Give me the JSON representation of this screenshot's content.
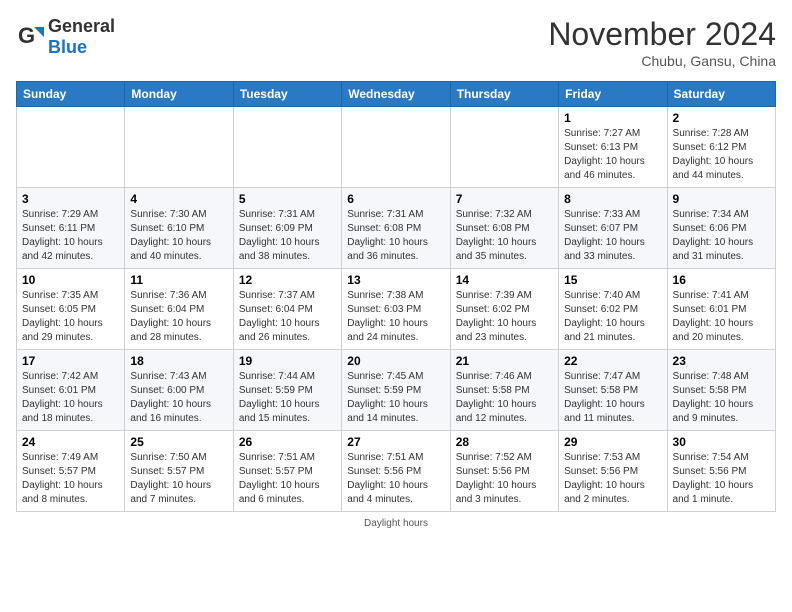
{
  "header": {
    "logo_general": "General",
    "logo_blue": "Blue",
    "month_title": "November 2024",
    "subtitle": "Chubu, Gansu, China"
  },
  "weekdays": [
    "Sunday",
    "Monday",
    "Tuesday",
    "Wednesday",
    "Thursday",
    "Friday",
    "Saturday"
  ],
  "weeks": [
    [
      {
        "day": "",
        "info": ""
      },
      {
        "day": "",
        "info": ""
      },
      {
        "day": "",
        "info": ""
      },
      {
        "day": "",
        "info": ""
      },
      {
        "day": "",
        "info": ""
      },
      {
        "day": "1",
        "info": "Sunrise: 7:27 AM\nSunset: 6:13 PM\nDaylight: 10 hours and 46 minutes."
      },
      {
        "day": "2",
        "info": "Sunrise: 7:28 AM\nSunset: 6:12 PM\nDaylight: 10 hours and 44 minutes."
      }
    ],
    [
      {
        "day": "3",
        "info": "Sunrise: 7:29 AM\nSunset: 6:11 PM\nDaylight: 10 hours and 42 minutes."
      },
      {
        "day": "4",
        "info": "Sunrise: 7:30 AM\nSunset: 6:10 PM\nDaylight: 10 hours and 40 minutes."
      },
      {
        "day": "5",
        "info": "Sunrise: 7:31 AM\nSunset: 6:09 PM\nDaylight: 10 hours and 38 minutes."
      },
      {
        "day": "6",
        "info": "Sunrise: 7:31 AM\nSunset: 6:08 PM\nDaylight: 10 hours and 36 minutes."
      },
      {
        "day": "7",
        "info": "Sunrise: 7:32 AM\nSunset: 6:08 PM\nDaylight: 10 hours and 35 minutes."
      },
      {
        "day": "8",
        "info": "Sunrise: 7:33 AM\nSunset: 6:07 PM\nDaylight: 10 hours and 33 minutes."
      },
      {
        "day": "9",
        "info": "Sunrise: 7:34 AM\nSunset: 6:06 PM\nDaylight: 10 hours and 31 minutes."
      }
    ],
    [
      {
        "day": "10",
        "info": "Sunrise: 7:35 AM\nSunset: 6:05 PM\nDaylight: 10 hours and 29 minutes."
      },
      {
        "day": "11",
        "info": "Sunrise: 7:36 AM\nSunset: 6:04 PM\nDaylight: 10 hours and 28 minutes."
      },
      {
        "day": "12",
        "info": "Sunrise: 7:37 AM\nSunset: 6:04 PM\nDaylight: 10 hours and 26 minutes."
      },
      {
        "day": "13",
        "info": "Sunrise: 7:38 AM\nSunset: 6:03 PM\nDaylight: 10 hours and 24 minutes."
      },
      {
        "day": "14",
        "info": "Sunrise: 7:39 AM\nSunset: 6:02 PM\nDaylight: 10 hours and 23 minutes."
      },
      {
        "day": "15",
        "info": "Sunrise: 7:40 AM\nSunset: 6:02 PM\nDaylight: 10 hours and 21 minutes."
      },
      {
        "day": "16",
        "info": "Sunrise: 7:41 AM\nSunset: 6:01 PM\nDaylight: 10 hours and 20 minutes."
      }
    ],
    [
      {
        "day": "17",
        "info": "Sunrise: 7:42 AM\nSunset: 6:01 PM\nDaylight: 10 hours and 18 minutes."
      },
      {
        "day": "18",
        "info": "Sunrise: 7:43 AM\nSunset: 6:00 PM\nDaylight: 10 hours and 16 minutes."
      },
      {
        "day": "19",
        "info": "Sunrise: 7:44 AM\nSunset: 5:59 PM\nDaylight: 10 hours and 15 minutes."
      },
      {
        "day": "20",
        "info": "Sunrise: 7:45 AM\nSunset: 5:59 PM\nDaylight: 10 hours and 14 minutes."
      },
      {
        "day": "21",
        "info": "Sunrise: 7:46 AM\nSunset: 5:58 PM\nDaylight: 10 hours and 12 minutes."
      },
      {
        "day": "22",
        "info": "Sunrise: 7:47 AM\nSunset: 5:58 PM\nDaylight: 10 hours and 11 minutes."
      },
      {
        "day": "23",
        "info": "Sunrise: 7:48 AM\nSunset: 5:58 PM\nDaylight: 10 hours and 9 minutes."
      }
    ],
    [
      {
        "day": "24",
        "info": "Sunrise: 7:49 AM\nSunset: 5:57 PM\nDaylight: 10 hours and 8 minutes."
      },
      {
        "day": "25",
        "info": "Sunrise: 7:50 AM\nSunset: 5:57 PM\nDaylight: 10 hours and 7 minutes."
      },
      {
        "day": "26",
        "info": "Sunrise: 7:51 AM\nSunset: 5:57 PM\nDaylight: 10 hours and 6 minutes."
      },
      {
        "day": "27",
        "info": "Sunrise: 7:51 AM\nSunset: 5:56 PM\nDaylight: 10 hours and 4 minutes."
      },
      {
        "day": "28",
        "info": "Sunrise: 7:52 AM\nSunset: 5:56 PM\nDaylight: 10 hours and 3 minutes."
      },
      {
        "day": "29",
        "info": "Sunrise: 7:53 AM\nSunset: 5:56 PM\nDaylight: 10 hours and 2 minutes."
      },
      {
        "day": "30",
        "info": "Sunrise: 7:54 AM\nSunset: 5:56 PM\nDaylight: 10 hours and 1 minute."
      }
    ]
  ],
  "footer": "Daylight hours"
}
